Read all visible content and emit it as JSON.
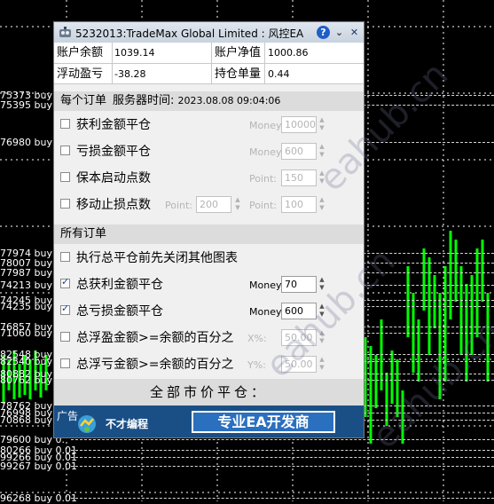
{
  "colors": {
    "chart_bg": "#000000",
    "candle": "#00ff00",
    "grid": "#ffffff",
    "order_line": "#d8d8d8",
    "ad_bg": "#1a4f86"
  },
  "orders": [
    {
      "label": "75373 buy 0."
    },
    {
      "label": "75395 buy 0."
    },
    {
      "label": "76980 buy"
    },
    {
      "label": "77974 buy"
    },
    {
      "label": "78007 buy"
    },
    {
      "label": "77987 buy"
    },
    {
      "label": "74213 buy"
    },
    {
      "label": "74245 buy"
    },
    {
      "label": "74235 buy"
    },
    {
      "label": "76857 buy"
    },
    {
      "label": "71060 buy"
    },
    {
      "label": "82548 buy"
    },
    {
      "label": "82540 buy"
    },
    {
      "label": "80882 buy"
    },
    {
      "label": "80762 buy"
    },
    {
      "label": "78762 buy"
    },
    {
      "label": "76998 buy"
    },
    {
      "label": "70868 buy"
    },
    {
      "label": "79600 buy 0."
    },
    {
      "label": "80266 buy 0.01"
    },
    {
      "label": "99266 buy 0.01"
    },
    {
      "label": "99267 buy 0.01"
    },
    {
      "label": "96268 buy 0.01"
    }
  ],
  "panel": {
    "title": "5232013:TradeMax Global Limited : 风控EA",
    "icons": {
      "app": "ea-app-icon",
      "help": "help-icon",
      "minimize": "chevron-down-icon",
      "close": "close-icon"
    },
    "help_glyph": "?",
    "min_glyph": "⌄",
    "close_glyph": "✕",
    "info": {
      "balance_label": "账户余额",
      "balance_value": "1039.14",
      "equity_label": "账户净值",
      "equity_value": "1000.86",
      "floating_label": "浮动盈亏",
      "floating_value": "-38.28",
      "position_label": "持仓单量",
      "position_value": "0.44"
    },
    "section1": {
      "left": "每个订单",
      "time_label": "服务器时间:",
      "time_value": "2023.08.08 09:04:06"
    },
    "rows1": [
      {
        "label": "获利金额平仓",
        "checked": false,
        "field_label": "Money",
        "field_value": "10000"
      },
      {
        "label": "亏损金额平仓",
        "checked": false,
        "field_label": "Money",
        "field_value": "600"
      },
      {
        "label": "保本启动点数",
        "checked": false,
        "field_label": "Point:",
        "field_value": "150"
      },
      {
        "label": "移动止损点数",
        "checked": false,
        "field_label_a": "Point:",
        "field_value_a": "200",
        "field_label": "Point:",
        "field_value": "100"
      }
    ],
    "section2": {
      "left": "所有订单"
    },
    "rows2": [
      {
        "label": "执行总平仓前先关闭其他图表",
        "checked": false
      },
      {
        "label": "总获利金额平仓",
        "checked": true,
        "field_label": "Money",
        "field_value": "70"
      },
      {
        "label": "总亏损金额平仓",
        "checked": true,
        "field_label": "Money",
        "field_value": "600"
      },
      {
        "label": "总浮盈金额>=余额的百分之",
        "checked": false,
        "field_label": "X%:",
        "field_value": "50.00"
      },
      {
        "label": "总浮亏金额>=余额的百分之",
        "checked": false,
        "field_label": "Y%:",
        "field_value": "50.00"
      }
    ],
    "close_all_label": "全部市价平仓：",
    "ad": {
      "tag": "广告",
      "brand": "不才编程",
      "button": "专业EA开发商",
      "logo_icon": "brand-logo-icon"
    }
  },
  "watermarks": [
    "eahub.cn",
    "eahub.cn",
    "eahub.cn"
  ]
}
